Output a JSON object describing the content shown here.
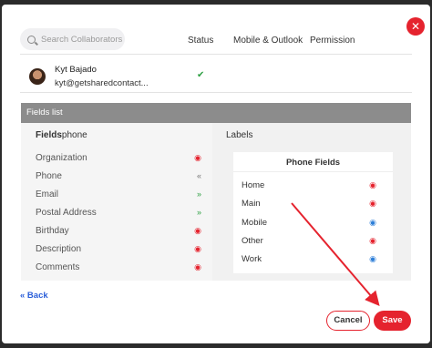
{
  "search": {
    "placeholder": "Search Collaborators"
  },
  "columns": {
    "status": "Status",
    "mobile_outlook": "Mobile & Outlook",
    "permission": "Permission"
  },
  "collaborator": {
    "name": "Kyt Bajado",
    "email": "kyt@getsharedcontact...",
    "status_icon": "check-icon"
  },
  "fields_list": {
    "title": "Fields list",
    "left_header_bold": "Fields",
    "left_header_rest": "phone",
    "labels_header": "Labels",
    "fields": [
      {
        "label": "Organization",
        "icon": "eye-slash-icon"
      },
      {
        "label": "Phone",
        "icon": "chevron-left-icon"
      },
      {
        "label": "Email",
        "icon": "chevron-right-icon"
      },
      {
        "label": "Postal Address",
        "icon": "chevron-right-icon"
      },
      {
        "label": "Birthday",
        "icon": "eye-slash-icon"
      },
      {
        "label": "Description",
        "icon": "eye-slash-icon"
      },
      {
        "label": "Comments",
        "icon": "eye-slash-icon"
      }
    ],
    "phone_fields": {
      "title": "Phone Fields",
      "items": [
        {
          "label": "Home",
          "icon": "eye-slash-icon"
        },
        {
          "label": "Main",
          "icon": "eye-slash-icon"
        },
        {
          "label": "Mobile",
          "icon": "eye-icon"
        },
        {
          "label": "Other",
          "icon": "eye-slash-icon"
        },
        {
          "label": "Work",
          "icon": "eye-icon"
        }
      ]
    }
  },
  "footer": {
    "back": "« Back",
    "cancel": "Cancel",
    "save": "Save"
  },
  "colors": {
    "accent": "#e5232e",
    "link": "#2b5fd9",
    "header_bar": "#8c8c8c"
  }
}
